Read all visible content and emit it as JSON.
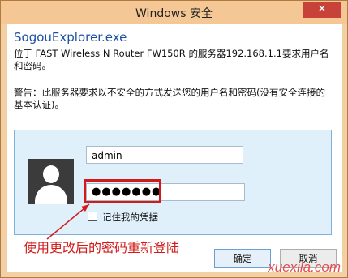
{
  "window": {
    "title": "Windows 安全",
    "close_label": "✕"
  },
  "dialog": {
    "app_name": "SogouExplorer.exe",
    "message": "位于 FAST Wireless N Router FW150R 的服务器192.168.1.1要求用户名和密码。",
    "warning": "警告：此服务器要求以不安全的方式发送您的用户名和密码(没有安全连接的基本认证)。"
  },
  "credentials": {
    "username_value": "admin",
    "password_mask": "●●●●●●●",
    "remember_label": "记住我的凭据",
    "remember_checked": false
  },
  "annotation": {
    "text": "使用更改后的密码重新登陆"
  },
  "buttons": {
    "ok_label": "确定",
    "cancel_label": "取消"
  },
  "watermark": "xuexila.com",
  "colors": {
    "annotation": "#d21a1a",
    "title_bar": "#f4c795",
    "panel": "#dff0fb"
  },
  "icons": {
    "avatar": "user-silhouette-icon"
  }
}
